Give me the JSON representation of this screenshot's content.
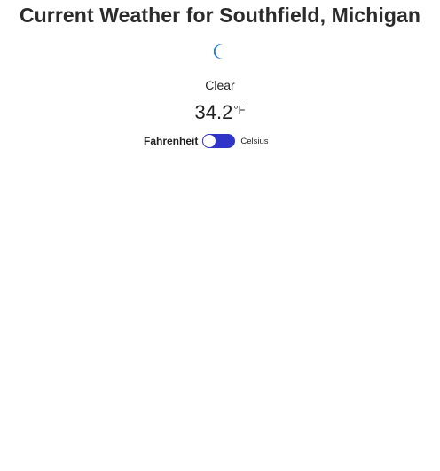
{
  "header": {
    "title": "Current Weather for Southfield, Michigan"
  },
  "weather": {
    "icon": "moon-icon",
    "icon_color": "#1e7ad6",
    "condition": "Clear",
    "temperature": "34.2",
    "unit_symbol": "°F"
  },
  "unit_toggle": {
    "left_label": "Fahrenheit",
    "right_label": "Celsius",
    "selected": "Fahrenheit",
    "track_color": "#2f36c7"
  }
}
